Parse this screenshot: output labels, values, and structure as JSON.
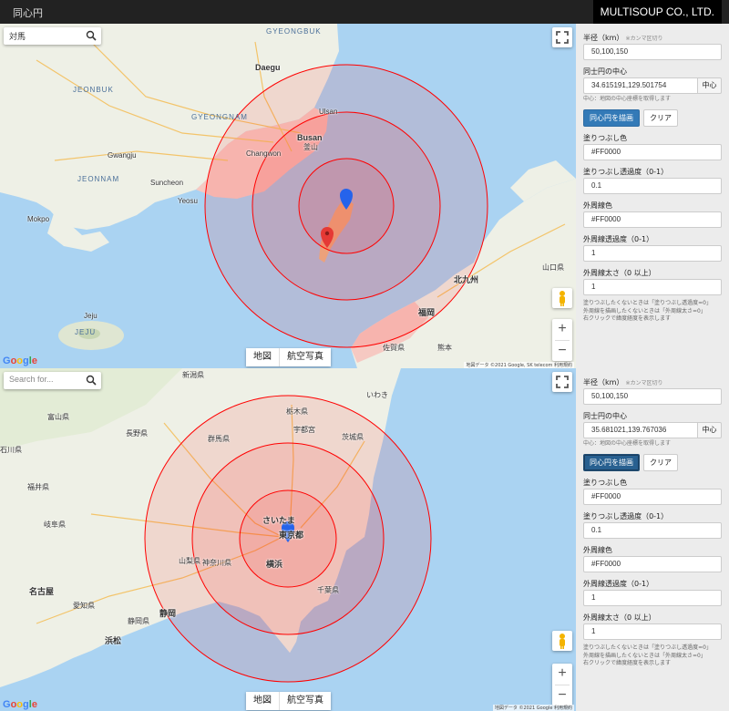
{
  "app": {
    "title": "同心円",
    "brand": "MULTISOUP CO., LTD."
  },
  "colors": {
    "fill": "#FF0000",
    "accent": "#337ab7",
    "topbar": "#222222"
  },
  "maps": [
    {
      "search_value": "対馬",
      "search_placeholder": "",
      "map_type_buttons": [
        "地図",
        "航空写真"
      ],
      "google_text": "Google",
      "attribution": "地図データ ©2021 Google, SK telecom  利用規約",
      "zoom_in": "+",
      "zoom_out": "−",
      "labels": [
        "GYEONGBUK",
        "GYEONGNAM",
        "JEONBUK",
        "JEONNAM",
        "Daegu",
        "Busan",
        "釜山",
        "Ulsan",
        "Gwangju",
        "Changwon",
        "Jeju",
        "JEJU",
        "福岡",
        "北九州",
        "山口県",
        "佐賀県",
        "熊本",
        "Mokpo",
        "Suncheon",
        "Yeosu"
      ]
    },
    {
      "search_value": "",
      "search_placeholder": "Search for...",
      "map_type_buttons": [
        "地図",
        "航空写真"
      ],
      "google_text": "Google",
      "attribution": "地図データ ©2021 Google  利用規約",
      "zoom_in": "+",
      "zoom_out": "−",
      "labels": [
        "新潟県",
        "いわき",
        "栃木県",
        "群馬県",
        "茨城県",
        "長野県",
        "さいたま",
        "東京都",
        "横浜",
        "千葉県",
        "山梨県",
        "静岡",
        "名古屋",
        "浜松",
        "岐阜県",
        "愛知県",
        "富山県",
        "石川県",
        "福井県",
        "静岡県",
        "神奈川県",
        "宇都宮"
      ]
    }
  ],
  "panels": [
    {
      "radius_label": "半径（km）",
      "radius_hint": "※カンマ区切り",
      "radius_value": "50,100,150",
      "center_label": "同士円の中心",
      "center_value": "34.615191,129.501754",
      "center_button": "中心",
      "center_help": "中心：地図の中心座標を取得します",
      "draw_button": "同心円を描画",
      "clear_button": "クリア",
      "fill_color_label": "塗りつぶし色",
      "fill_color_value": "#FF0000",
      "fill_opacity_label": "塗りつぶし透過度（0-1）",
      "fill_opacity_value": "0.1",
      "stroke_color_label": "外周線色",
      "stroke_color_value": "#FF0000",
      "stroke_opacity_label": "外周線透過度（0-1）",
      "stroke_opacity_value": "1",
      "stroke_weight_label": "外周線太さ（0 以上）",
      "stroke_weight_value": "1",
      "note1": "塗りつぶしたくないときは「塗りつぶし透過度=0」",
      "note2": "外周線を描画したくないときは「外周線太さ=0」",
      "note3": "右クリックで緯度経度を表示します"
    },
    {
      "radius_label": "半径（km）",
      "radius_hint": "※カンマ区切り",
      "radius_value": "50,100,150",
      "center_label": "同士円の中心",
      "center_value": "35.681021,139.767036",
      "center_button": "中心",
      "center_help": "中心：地図の中心座標を取得します",
      "draw_button": "同心円を描画",
      "clear_button": "クリア",
      "fill_color_label": "塗りつぶし色",
      "fill_color_value": "#FF0000",
      "fill_opacity_label": "塗りつぶし透過度（0-1）",
      "fill_opacity_value": "0.1",
      "stroke_color_label": "外周線色",
      "stroke_color_value": "#FF0000",
      "stroke_opacity_label": "外周線透過度（0-1）",
      "stroke_opacity_value": "1",
      "stroke_weight_label": "外周線太さ（0 以上）",
      "stroke_weight_value": "1",
      "note1": "塗りつぶしたくないときは「塗りつぶし透過度=0」",
      "note2": "外周線を描画したくないときは「外周線太さ=0」",
      "note3": "右クリックで緯度経度を表示します"
    }
  ]
}
